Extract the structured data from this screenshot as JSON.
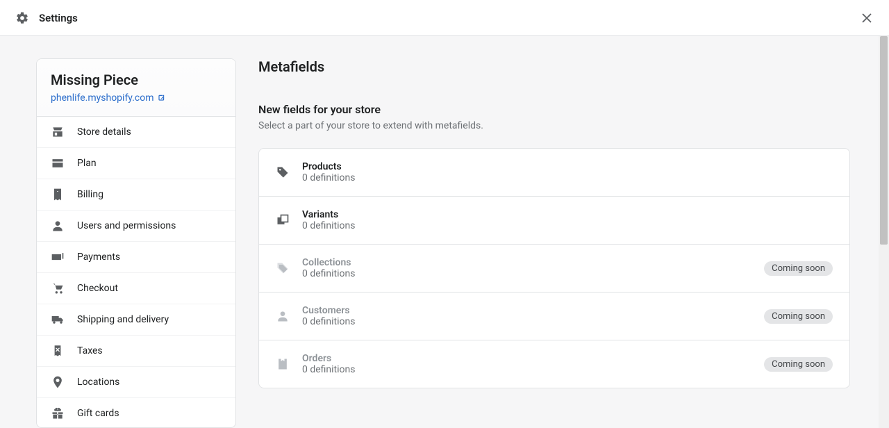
{
  "topbar": {
    "title": "Settings"
  },
  "sidebar": {
    "store_name": "Missing Piece",
    "store_url": "phenlife.myshopify.com",
    "items": [
      {
        "label": "Store details"
      },
      {
        "label": "Plan"
      },
      {
        "label": "Billing"
      },
      {
        "label": "Users and permissions"
      },
      {
        "label": "Payments"
      },
      {
        "label": "Checkout"
      },
      {
        "label": "Shipping and delivery"
      },
      {
        "label": "Taxes"
      },
      {
        "label": "Locations"
      },
      {
        "label": "Gift cards"
      }
    ]
  },
  "main": {
    "title": "Metafields",
    "section_title": "New fields for your store",
    "section_sub": "Select a part of your store to extend with metafields.",
    "rows": [
      {
        "title": "Products",
        "sub": "0 definitions",
        "badge": "",
        "enabled": true
      },
      {
        "title": "Variants",
        "sub": "0 definitions",
        "badge": "",
        "enabled": true
      },
      {
        "title": "Collections",
        "sub": "0 definitions",
        "badge": "Coming soon",
        "enabled": false
      },
      {
        "title": "Customers",
        "sub": "0 definitions",
        "badge": "Coming soon",
        "enabled": false
      },
      {
        "title": "Orders",
        "sub": "0 definitions",
        "badge": "Coming soon",
        "enabled": false
      }
    ]
  }
}
